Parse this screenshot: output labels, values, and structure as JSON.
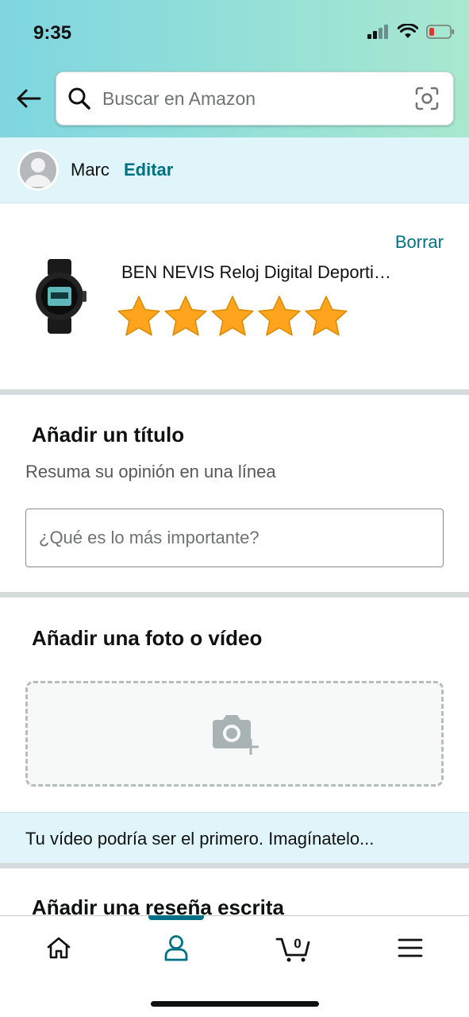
{
  "status_bar": {
    "time": "9:35"
  },
  "search": {
    "placeholder": "Buscar en Amazon"
  },
  "profile": {
    "name": "Marc",
    "edit_label": "Editar"
  },
  "product": {
    "delete_label": "Borrar",
    "title": "BEN NEVIS Reloj Digital Deporti…",
    "rating": 5,
    "rating_max": 5
  },
  "title_section": {
    "heading": "Añadir un título",
    "subtitle": "Resuma su opinión en una línea",
    "input_placeholder": "¿Qué es lo más importante?"
  },
  "media_section": {
    "heading": "Añadir una foto o vídeo"
  },
  "video_banner": {
    "text": "Tu vídeo podría ser el primero. Imagínatelo..."
  },
  "review_section": {
    "heading": "Añadir una reseña escrita"
  },
  "tabbar": {
    "active_tab": "profile",
    "cart_count": "0",
    "tabs": [
      {
        "icon": "home-icon"
      },
      {
        "icon": "user-icon"
      },
      {
        "icon": "cart-icon"
      },
      {
        "icon": "menu-icon"
      }
    ]
  },
  "colors": {
    "accent": "#007185",
    "star": "#FFA41C",
    "banner": "#DFF5F9"
  }
}
